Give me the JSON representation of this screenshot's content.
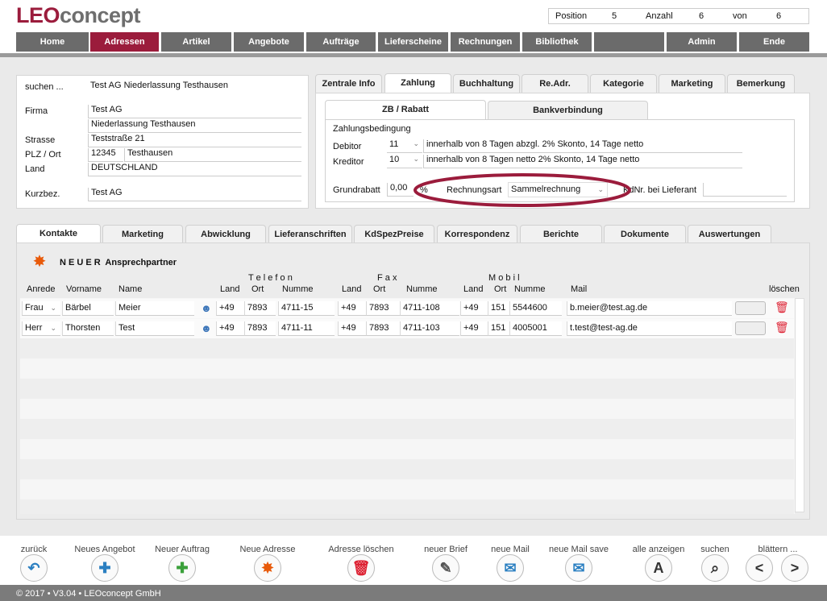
{
  "app": {
    "logo_a": "LEO",
    "logo_b": "concept"
  },
  "position": {
    "pos_label": "Position",
    "pos_val": "5",
    "count_label": "Anzahl",
    "count_val": "6",
    "of_label": "von",
    "of_val": "6"
  },
  "nav": [
    "Home",
    "Adressen",
    "Artikel",
    "Angebote",
    "Aufträge",
    "Lieferscheine",
    "Rechnungen",
    "Bibliothek",
    "",
    "Admin",
    "Ende"
  ],
  "addr": {
    "search_label": "suchen ...",
    "search_val": "Test AG Niederlassung Testhausen",
    "firma_label": "Firma",
    "firma1": "Test AG",
    "firma2": "Niederlassung Testhausen",
    "strasse_label": "Strasse",
    "strasse": "Teststraße 21",
    "plz_label": "PLZ / Ort",
    "plz": "12345",
    "ort": "Testhausen",
    "land_label": "Land",
    "land": "DEUTSCHLAND",
    "kurz_label": "Kurzbez.",
    "kurz": "Test AG"
  },
  "right_tabs": [
    "Zentrale Info",
    "Zahlung",
    "Buchhaltung",
    "Re.Adr.",
    "Kategorie",
    "Marketing",
    "Bemerkung"
  ],
  "sub_tabs": [
    "ZB / Rabatt",
    "Bankverbindung"
  ],
  "payment": {
    "title": "Zahlungsbedingung",
    "debitor_label": "Debitor",
    "debitor_val": "11",
    "debitor_text": "innerhalb von 8 Tagen abzgl. 2% Skonto, 14 Tage netto",
    "kreditor_label": "Kreditor",
    "kreditor_val": "10",
    "kreditor_text": "innerhalb von 8 Tagen netto 2% Skonto, 14 Tage netto",
    "grund_label": "Grundrabatt",
    "grund_val": "0,00",
    "pct": "%",
    "rechnungsart_label": "Rechnungsart",
    "rechnungsart_val": "Sammelrechnung",
    "kdnr_label": "KdNr. bei Lieferant"
  },
  "bottom_tabs": [
    "Kontakte",
    "Marketing",
    "Abwicklung",
    "Lieferanschriften",
    "KdSpezPreise",
    "Korrespondenz",
    "Berichte",
    "Dokumente",
    "Auswertungen"
  ],
  "contacts": {
    "new_label": "N E U E R  Ansprechpartner",
    "group_tel": "T e l e f o n",
    "group_fax": "F a x",
    "group_mob": "M o b i l",
    "headers": {
      "anrede": "Anrede",
      "vorname": "Vorname",
      "name": "Name",
      "land": "Land",
      "ort": "Ort",
      "nummer": "Numme",
      "mail": "Mail",
      "delete": "löschen"
    },
    "rows": [
      {
        "anrede": "Frau",
        "vorname": "Bärbel",
        "name": "Meier",
        "tl": "+49",
        "to": "7893",
        "tn": "4711-15",
        "fl": "+49",
        "fo": "7893",
        "fn": "4711-108",
        "ml": "+49",
        "mo": "151",
        "mn": "5544600",
        "mail": "b.meier@test.ag.de"
      },
      {
        "anrede": "Herr",
        "vorname": "Thorsten",
        "name": "Test",
        "tl": "+49",
        "to": "7893",
        "tn": "4711-11",
        "fl": "+49",
        "fo": "7893",
        "fn": "4711-103",
        "ml": "+49",
        "mo": "151",
        "mn": "4005001",
        "mail": "t.test@test-ag.de"
      }
    ]
  },
  "bottom_buttons": [
    "zurück",
    "Neues Angebot",
    "Neuer Auftrag",
    "Neue Adresse",
    "Adresse löschen",
    "neuer Brief",
    "neue Mail",
    "neue Mail save",
    "alle anzeigen",
    "suchen",
    "blättern ..."
  ],
  "icons": {
    "a_letter": "A",
    "prev": "<",
    "next": ">"
  },
  "footer": "© 2017 • V3.04 • LEOconcept GmbH",
  "colors": {
    "brand": "#9b1c3c",
    "nav": "#6b6b6b"
  }
}
